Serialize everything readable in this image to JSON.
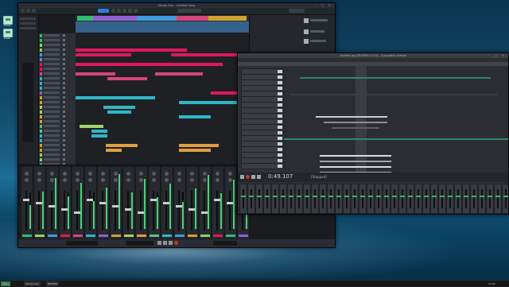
{
  "desktop": {
    "icons": [
      {
        "label": "Home",
        "icon": "folder-icon"
      },
      {
        "label": "Trash",
        "icon": "trash-icon"
      }
    ]
  },
  "daw_window": {
    "title": "Studio One - Untitled Song",
    "colors": {
      "accent": "#2f7de1",
      "selection": "#e1185a"
    }
  },
  "mixer": {
    "channel_count": 18
  },
  "reaper_window": {
    "title": "untitled.rpp [REAPER v7.xx] - Evaluation license",
    "time_display": "0:49.107",
    "play_state": "[Stopped]"
  },
  "taskbar": {
    "start_label": "Menu",
    "items": [
      "Studio One",
      "REAPER"
    ],
    "clock": "23:45"
  }
}
